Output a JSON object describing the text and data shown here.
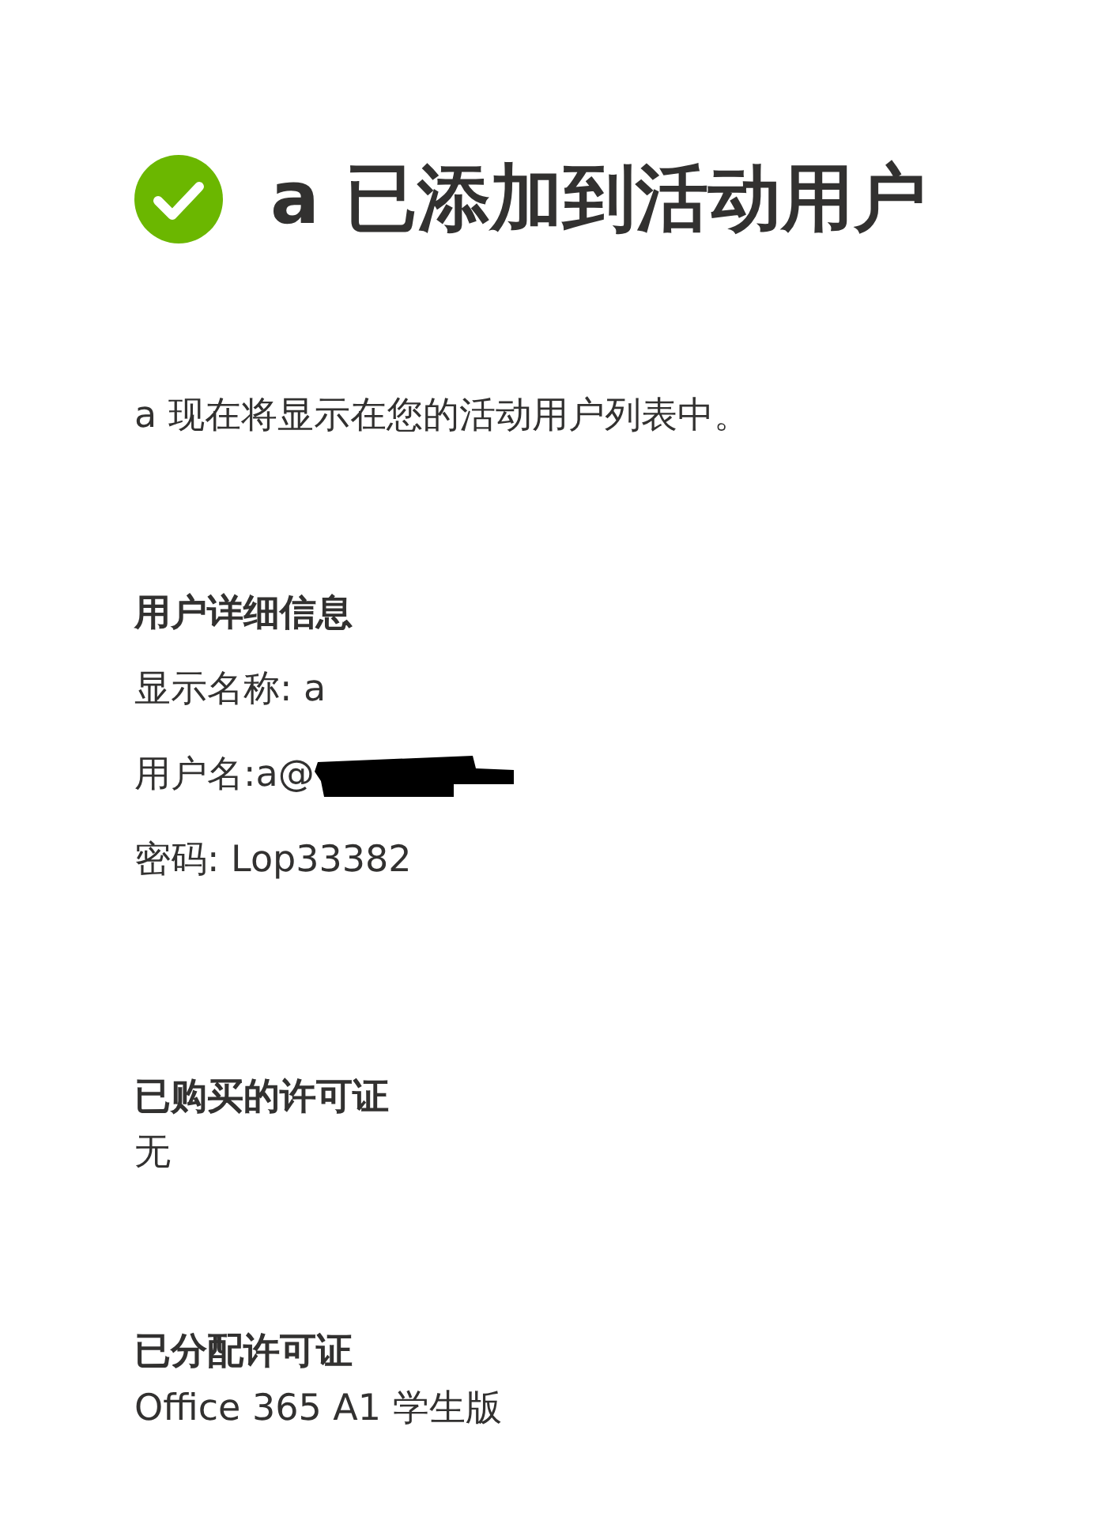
{
  "header": {
    "title": "a 已添加到活动用户"
  },
  "message": "a 现在将显示在您的活动用户列表中。",
  "sections": [
    {
      "heading": "用户详细信息",
      "lines": [
        {
          "text": "显示名称: a",
          "redacted": false
        },
        {
          "text": "用户名:a@",
          "redacted": true
        },
        {
          "text": "密码: Lop33382",
          "redacted": false
        }
      ]
    },
    {
      "heading": "已购买的许可证",
      "lines": [
        {
          "text": "无",
          "redacted": false
        }
      ]
    },
    {
      "heading": "已分配许可证",
      "lines": [
        {
          "text": "Office 365 A1 学生版",
          "redacted": false
        }
      ]
    }
  ]
}
